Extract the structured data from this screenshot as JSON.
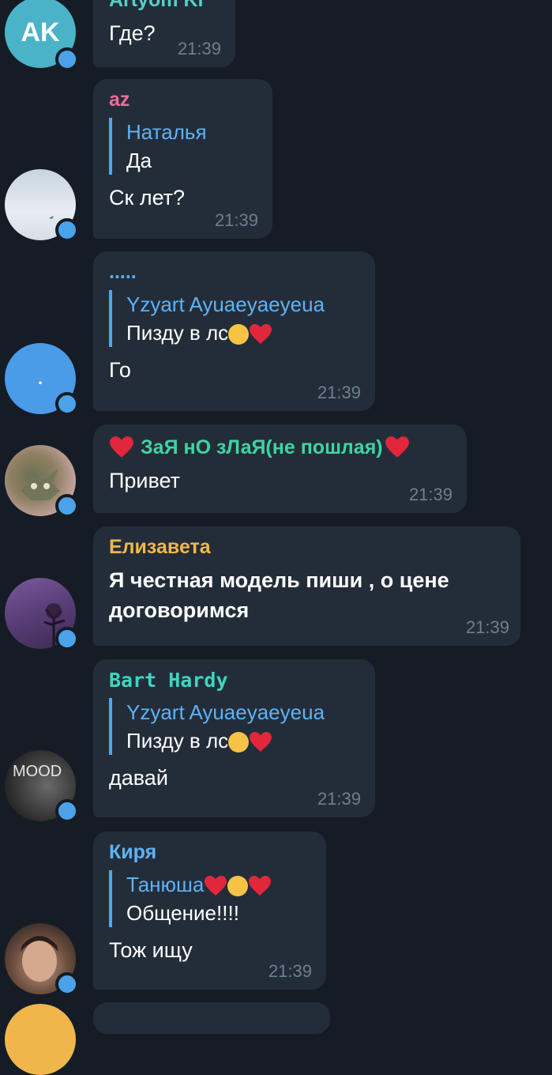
{
  "colors": {
    "background": "#151c26",
    "bubble": "#232d39",
    "reply_bar": "#54a5f0",
    "reply_name": "#5eb2f5",
    "time": "#6d7f91",
    "online_dot": "#4aa3ea"
  },
  "messages": [
    {
      "sender": "Artyom Kr",
      "sender_color": "#55d0c6",
      "avatar_initials": "AK",
      "avatar_color": "#4ab3c8",
      "text": "Где?",
      "time": "21:39"
    },
    {
      "sender": "az",
      "sender_color": "#ef6a9a",
      "reply_name": "Наталья",
      "reply_text": "Да",
      "text": "Ск лет?",
      "time": "21:39"
    },
    {
      "sender": ".....",
      "sender_color": "#5eb2f5",
      "avatar_text": ".",
      "avatar_color": "#4a9be8",
      "reply_name": "Yzyart Ayuaeyaeyeua",
      "reply_text": "Пизду в лс",
      "text": "Го",
      "time": "21:39"
    },
    {
      "sender": "ЗаЯ нО зЛаЯ(не пошлая)",
      "sender_color": "#3fd4a4",
      "text": "Привет",
      "time": "21:39"
    },
    {
      "sender": "Елизавета",
      "sender_color": "#f0b64c",
      "text": "Я честная модель пиши , о цене договоримся",
      "time": "21:39"
    },
    {
      "sender": "Bart Hardy",
      "sender_color": "#3fd4c0",
      "avatar_text": "MOOD",
      "reply_name": "Yzyart Ayuaeyaeyeua",
      "reply_text": "Пизду в лс",
      "text": "давай",
      "time": "21:39"
    },
    {
      "sender": "Киря",
      "sender_color": "#5eb2f5",
      "reply_name": "Танюша",
      "reply_text": "Общение!!!!",
      "text": "Тож ищу",
      "time": "21:39"
    }
  ]
}
